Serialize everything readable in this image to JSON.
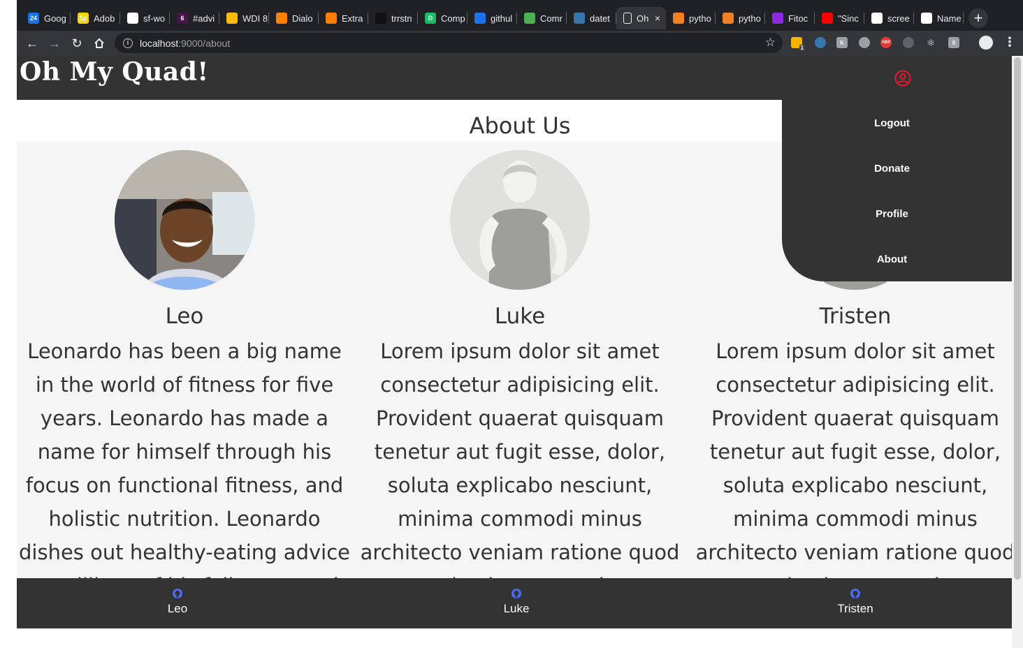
{
  "browser": {
    "tabs": [
      {
        "title": "Goog",
        "icon": "google-calendar-icon",
        "color": "#1a73e8",
        "glyph": "24"
      },
      {
        "title": "Adob",
        "icon": "adobe-spark-icon",
        "color": "#f9d400",
        "glyph": "Sp"
      },
      {
        "title": "sf-wo",
        "icon": "github-icon",
        "color": "#ffffff",
        "glyph": ""
      },
      {
        "title": "#advi",
        "icon": "slack-icon",
        "color": "#4a154b",
        "glyph": "6"
      },
      {
        "title": "WDI 8",
        "icon": "slides-icon",
        "color": "#fbbc04",
        "glyph": ""
      },
      {
        "title": "Dialo",
        "icon": "dialogflow-icon",
        "color": "#ff7f00",
        "glyph": ""
      },
      {
        "title": "Extra",
        "icon": "dialogflow-icon",
        "color": "#ff7f00",
        "glyph": ""
      },
      {
        "title": "trrstn",
        "icon": "dark-circle-icon",
        "color": "#111111",
        "glyph": ""
      },
      {
        "title": "Comp",
        "icon": "d-letter-icon",
        "color": "#16c060",
        "glyph": "D"
      },
      {
        "title": "githul",
        "icon": "flag-icon",
        "color": "#1a73e8",
        "glyph": ""
      },
      {
        "title": "Comr",
        "icon": "qr-icon",
        "color": "#4caf50",
        "glyph": ""
      },
      {
        "title": "datet",
        "icon": "python-icon",
        "color": "#3776ab",
        "glyph": ""
      },
      {
        "title": "Oh",
        "icon": "document-icon",
        "color": "#35363a",
        "glyph": "",
        "active": true
      },
      {
        "title": "pytho",
        "icon": "stackoverflow-icon",
        "color": "#f48024",
        "glyph": ""
      },
      {
        "title": "pytho",
        "icon": "stackoverflow-icon",
        "color": "#f48024",
        "glyph": ""
      },
      {
        "title": "Fitoc",
        "icon": "purple-logo-icon",
        "color": "#8a2be2",
        "glyph": ""
      },
      {
        "title": "\"Sinc",
        "icon": "youtube-icon",
        "color": "#ff0000",
        "glyph": ""
      },
      {
        "title": "scree",
        "icon": "google-icon",
        "color": "#ffffff",
        "glyph": ""
      },
      {
        "title": "Name",
        "icon": "google-icon",
        "color": "#ffffff",
        "glyph": ""
      }
    ],
    "url_host": "localhost",
    "url_path": ":9000/about",
    "extension_badge": "1",
    "abp_label": "ABP"
  },
  "site": {
    "brand": "Oh My Quad!",
    "accent": "#e8192c",
    "section_title": "About Us",
    "menu": [
      "Logout",
      "Donate",
      "Profile",
      "About"
    ]
  },
  "members": [
    {
      "name": "Leo",
      "bio": "Leonardo has been a big name in the world of fitness for five years. Leonardo has made a name for himself through his focus on functional fitness, and holistic nutrition. Leonardo dishes out healthy-eating advice to millions of his followers and steers people",
      "avatar": "photo"
    },
    {
      "name": "Luke",
      "bio": "Lorem ipsum dolor sit amet consectetur adipisicing elit. Provident quaerat quisquam tenetur aut fugit esse, dolor, soluta explicabo nesciunt, minima commodi minus architecto veniam ratione quod quasi voluptatum vitae",
      "avatar": "placeholder"
    },
    {
      "name": "Tristen",
      "bio": "Lorem ipsum dolor sit amet consectetur adipisicing elit. Provident quaerat quisquam tenetur aut fugit esse, dolor, soluta explicabo nesciunt, minima commodi minus architecto veniam ratione quod quasi voluptatum vitae",
      "avatar": "placeholder"
    }
  ],
  "footer": {
    "links": [
      "Leo",
      "Luke",
      "Tristen"
    ],
    "icon_color": "#4a6cf7"
  }
}
